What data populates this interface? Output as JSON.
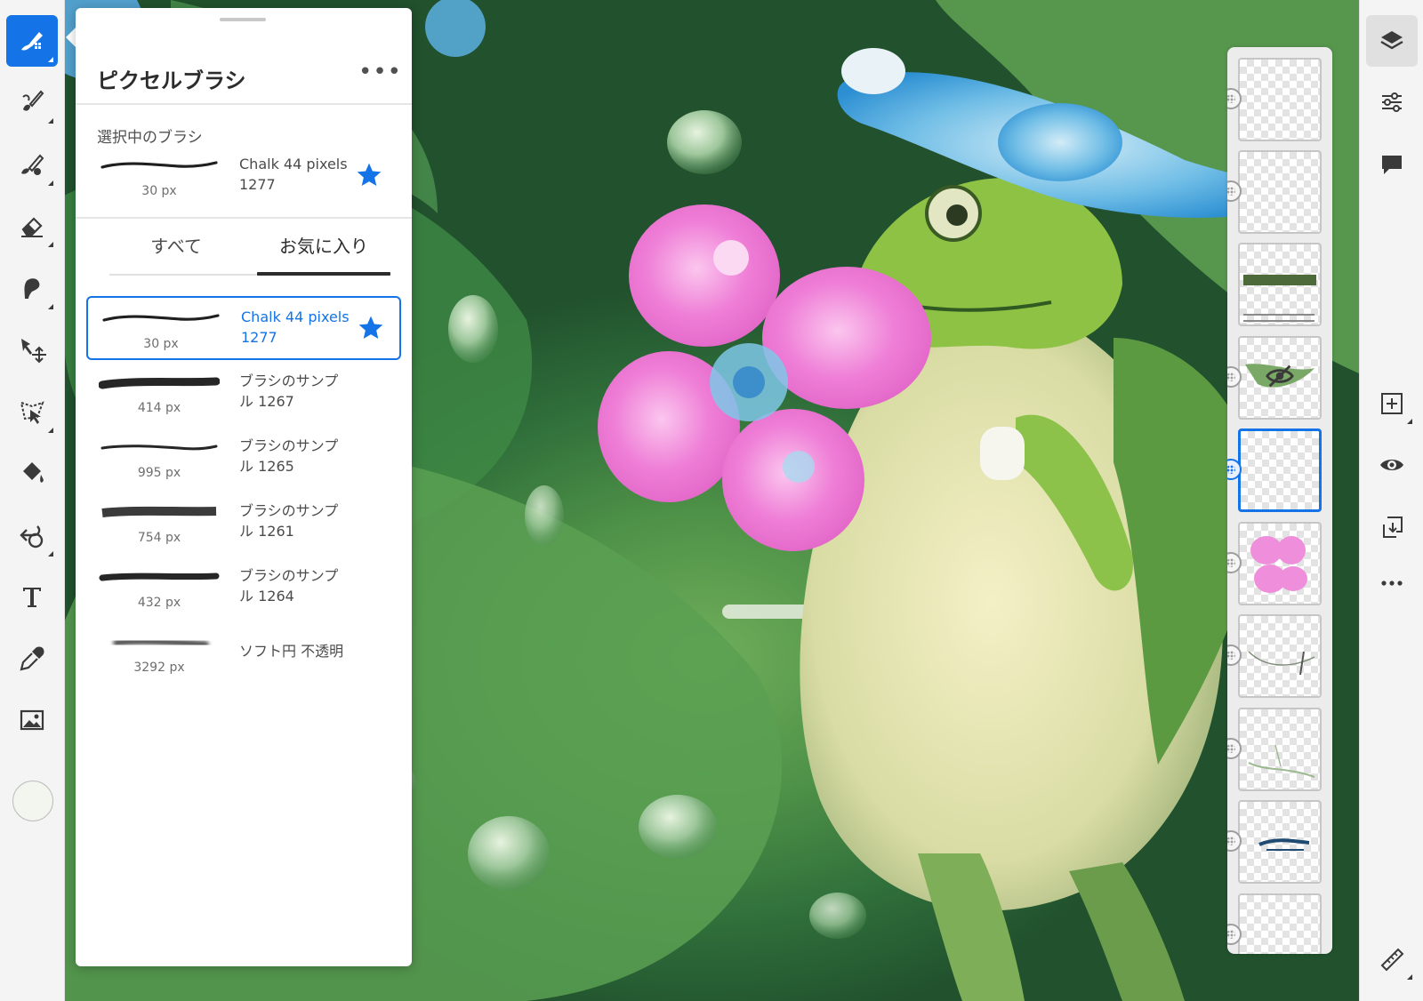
{
  "brush_panel": {
    "title": "ピクセルブラシ",
    "more_label": "•••",
    "selected_section_label": "選択中のブラシ",
    "selected_brush": {
      "name": "Chalk 44 pixels",
      "number": "1277",
      "size": "30 px",
      "favorite": true
    },
    "tabs": [
      {
        "label": "すべて",
        "active": false
      },
      {
        "label": "お気に入り",
        "active": true
      }
    ],
    "brushes": [
      {
        "name_line1": "Chalk 44 pixels",
        "name_line2": "1277",
        "size": "30 px",
        "selected": true,
        "favorite": true
      },
      {
        "name_line1": "ブラシのサンプ",
        "name_line2": "ル 1267",
        "size": "414 px",
        "selected": false,
        "favorite": false
      },
      {
        "name_line1": "ブラシのサンプ",
        "name_line2": "ル 1265",
        "size": "995 px",
        "selected": false,
        "favorite": false
      },
      {
        "name_line1": "ブラシのサンプ",
        "name_line2": "ル 1261",
        "size": "754 px",
        "selected": false,
        "favorite": false
      },
      {
        "name_line1": "ブラシのサンプ",
        "name_line2": "ル 1264",
        "size": "432 px",
        "selected": false,
        "favorite": false
      },
      {
        "name_line1": "ソフト円 不透明",
        "name_line2": "",
        "size": "3292 px",
        "selected": false,
        "favorite": false
      }
    ]
  },
  "left_toolbar": {
    "tools": [
      "pixel-brush-icon",
      "live-brush-icon",
      "mixer-brush-icon",
      "eraser-icon",
      "smudge-icon",
      "transform-icon",
      "lasso-select-icon",
      "fill-icon",
      "liquify-icon",
      "text-icon",
      "eyedropper-icon",
      "place-image-icon"
    ],
    "active_tool": "pixel-brush-icon",
    "current_color": "#f3f5ef"
  },
  "right_toolbar": {
    "tools": [
      "layers-icon",
      "layer-properties-icon",
      "comments-icon",
      "add-layer-icon",
      "visibility-icon",
      "merge-down-icon",
      "more-icon",
      "ruler-icon"
    ],
    "active_tool": "layers-icon"
  },
  "layers": {
    "count_visible": 10,
    "active_index": 4,
    "hidden_index": 3
  },
  "colors": {
    "accent": "#1473e6",
    "panel_bg": "#ffffff",
    "toolbar_bg": "#f4f4f4"
  }
}
